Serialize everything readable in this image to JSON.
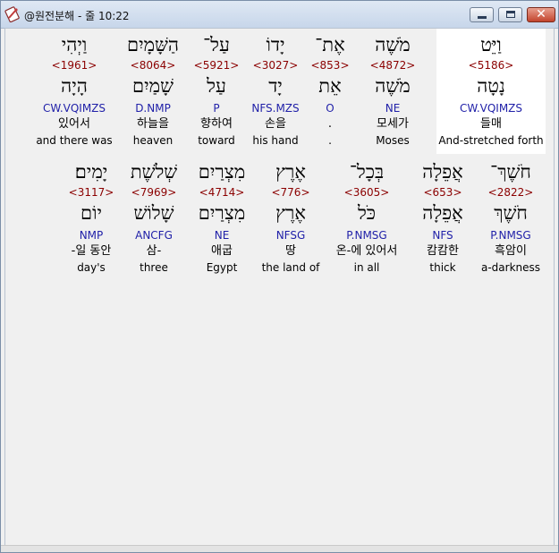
{
  "window": {
    "title": "@원전분해 - 줄 10:22",
    "controls": {
      "minimize": "minimize",
      "maximize": "maximize",
      "close": "✕"
    }
  },
  "rows": [
    {
      "words": [
        {
          "hebrew": "וַיְהִי",
          "strong": "<1961>",
          "lemma": "הָיָה",
          "code": "CW.VQIMZS",
          "korean": "있어서",
          "english": "and there was"
        },
        {
          "hebrew": "הַשָּׁמָיִם",
          "strong": "<8064>",
          "lemma": "שָׁמַיִם",
          "code": "D.NMP",
          "korean": "하늘을",
          "english": "heaven"
        },
        {
          "hebrew": "עַל־",
          "strong": "<5921>",
          "lemma": "עַל",
          "code": "P",
          "korean": "향하여",
          "english": "toward"
        },
        {
          "hebrew": "יָדוֹ",
          "strong": "<3027>",
          "lemma": "יָד",
          "code": "NFS.MZS",
          "korean": "손을",
          "english": "his hand"
        },
        {
          "hebrew": "אֶת־",
          "strong": "<853>",
          "lemma": "אֵת",
          "code": "O",
          "korean": ".",
          "english": "."
        },
        {
          "hebrew": "מֹשֶׁה",
          "strong": "<4872>",
          "lemma": "מֹשֶׁה",
          "code": "NE",
          "korean": "모세가",
          "english": "Moses"
        },
        {
          "hebrew": "וַיֵּט",
          "strong": "<5186>",
          "lemma": "נָטָה",
          "code": "CW.VQIMZS",
          "korean": "들매",
          "english": "And-stretched forth"
        }
      ]
    },
    {
      "words": [
        {
          "hebrew": "יָמִים׃",
          "strong": "<3117>",
          "lemma": "יוֹם",
          "code": "NMP",
          "korean": "-일 동안",
          "english": "day's"
        },
        {
          "hebrew": "שְׁלֹשֶׁת",
          "strong": "<7969>",
          "lemma": "שָׁלוֹשׁ",
          "code": "ANCFG",
          "korean": "삼-",
          "english": "three"
        },
        {
          "hebrew": "מִצְרַיִם",
          "strong": "<4714>",
          "lemma": "מִצְרַיִם",
          "code": "NE",
          "korean": "애굽",
          "english": "Egypt"
        },
        {
          "hebrew": "אֶרֶץ",
          "strong": "<776>",
          "lemma": "אֶרֶץ",
          "code": "NFSG",
          "korean": "땅",
          "english": "the land of"
        },
        {
          "hebrew": "בְּכָל־",
          "strong": "<3605>",
          "lemma": "כֹּל",
          "code": "P.NMSG",
          "korean": "온-에 있어서",
          "english": "in all"
        },
        {
          "hebrew": "אֲפֵלָה",
          "strong": "<653>",
          "lemma": "אֲפֵלָה",
          "code": "NFS",
          "korean": "캄캄한",
          "english": "thick"
        },
        {
          "hebrew": "חֹשֶׁךְ־",
          "strong": "<2822>",
          "lemma": "חֹשֶׁךְ",
          "code": "P.NMSG",
          "korean": "흑암이",
          "english": "a-darkness"
        }
      ]
    }
  ],
  "colors": {
    "strong_number": "#8b0000",
    "morph_code": "#1f1fa8",
    "selected_cell": "#ffffff",
    "background": "#f0f0f0"
  }
}
